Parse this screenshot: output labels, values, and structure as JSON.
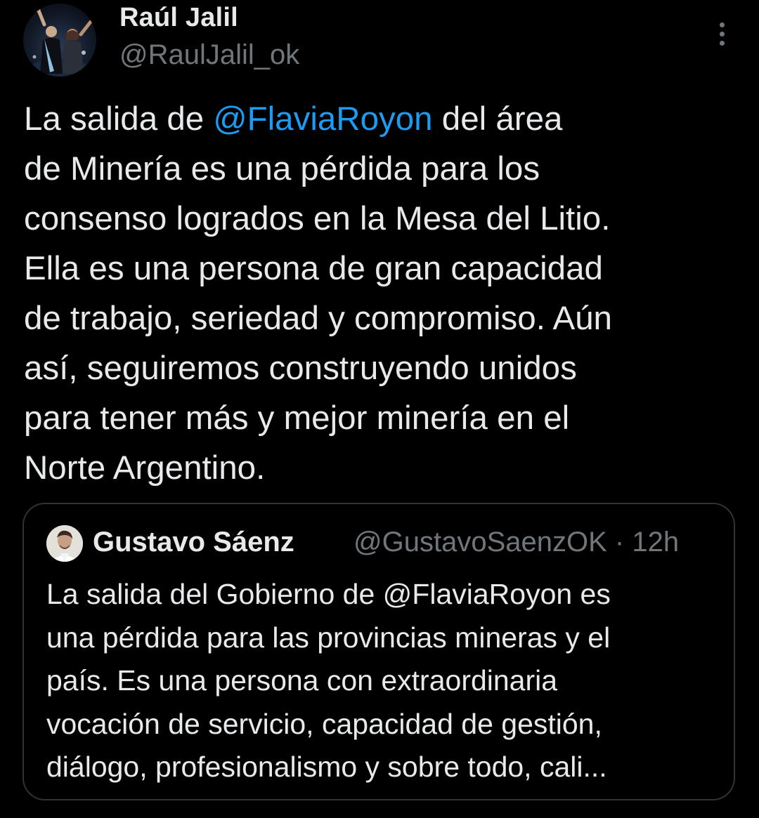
{
  "author": {
    "display_name": "Raúl Jalil",
    "handle": "@RaulJalil_ok",
    "avatar_icon": "profile-photo-icon"
  },
  "more_icon": "more-options-icon",
  "tweet": {
    "lines": [
      {
        "parts": [
          "La salida de ",
          "@FlaviaRoyon",
          " del área"
        ]
      },
      {
        "text": "de Minería es una pérdida para los"
      },
      {
        "text": "consenso logrados en la Mesa del Litio."
      },
      {
        "text": "Ella es una persona de gran capacidad"
      },
      {
        "text": "de trabajo, seriedad y compromiso. Aún"
      },
      {
        "text": "así, seguiremos construyendo unidos"
      },
      {
        "text": "para tener más y mejor minería en el"
      },
      {
        "text": "Norte Argentino."
      }
    ]
  },
  "quoted_tweet": {
    "display_name": "Gustavo Sáenz",
    "meta": "@GustavoSaenzOK · 12h",
    "avatar_icon": "profile-photo-icon",
    "lines": [
      "La salida del Gobierno de @FlaviaRoyon es",
      "una pérdida para las provincias mineras y el",
      "país. Es una persona con extraordinaria",
      "vocación de servicio, capacidad de gestión,",
      "diálogo, profesionalismo y sobre todo, cali..."
    ]
  },
  "colors": {
    "background": "#000000",
    "text_primary": "#e7e9ea",
    "text_secondary": "#71767b",
    "link": "#1d9bf0",
    "border": "#2f3336"
  }
}
